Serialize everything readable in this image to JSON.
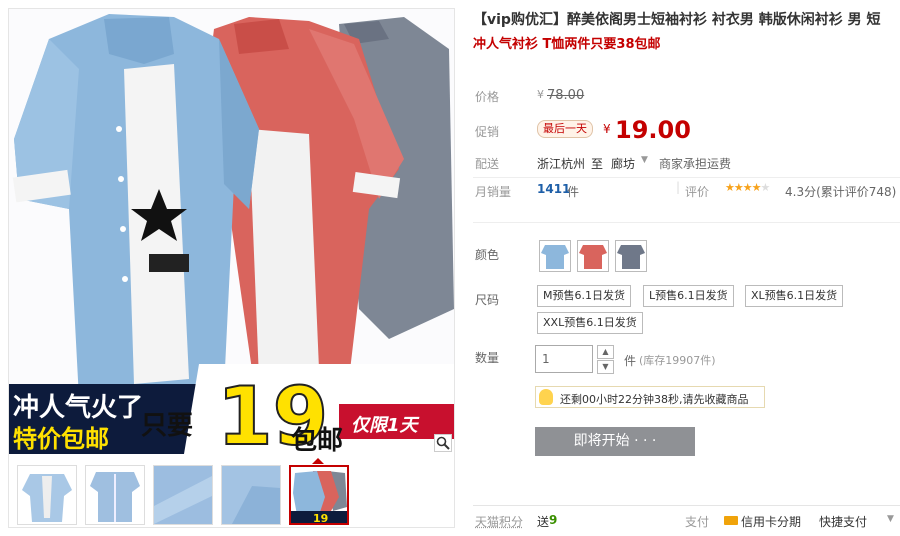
{
  "gallery": {
    "banner": {
      "line1": "冲人气火了",
      "line2": "特价包邮",
      "only": "只要",
      "big_number": "19",
      "shipping": "包邮",
      "limited": "仅限1天"
    },
    "thumbs": [
      {
        "name": "thumb-1"
      },
      {
        "name": "thumb-2"
      },
      {
        "name": "thumb-3"
      },
      {
        "name": "thumb-4"
      },
      {
        "name": "thumb-5",
        "selected": true
      }
    ],
    "zoom_icon": "magnifier-icon"
  },
  "product": {
    "title": "【vip购优汇】醉美依阁男士短袖衬衫 衬衣男 韩版休闲衬衫 男 短",
    "subtitle": "冲人气衬衫 T恤两件只要38包邮"
  },
  "price": {
    "label": "价格",
    "original": "78.00",
    "currency": "¥",
    "promo_label": "促销",
    "promo_tag": "最后一天",
    "current": "19.00"
  },
  "shipping": {
    "label": "配送",
    "from": "浙江杭州",
    "to_word": "至",
    "to": "廊坊",
    "fee": "商家承担运费"
  },
  "sales": {
    "label": "月销量",
    "count": "1411",
    "unit": "件",
    "rating_label": "评价",
    "rating": 4.3,
    "rating_text": "4.3分(累计评价748)"
  },
  "color": {
    "label": "颜色",
    "options": [
      "浅蓝",
      "红色",
      "灰色"
    ]
  },
  "size": {
    "label": "尺码",
    "options": [
      "M预售6.1日发货",
      "L预售6.1日发货",
      "XL预售6.1日发货",
      "XXL预售6.1日发货"
    ]
  },
  "quantity": {
    "label": "数量",
    "value": "1",
    "unit": "件",
    "stock": "(库存19907件)"
  },
  "tip": {
    "text": "还剩00小时22分钟38秒,请先收藏商品"
  },
  "buy_button": {
    "label": "即将开始 · · ·"
  },
  "footer": {
    "points_label": "天猫积分",
    "points_prefix": "送",
    "points": "9",
    "pay_label": "支付",
    "credit": "信用卡分期",
    "express": "快捷支付"
  },
  "colors": {
    "accent": "#c40000",
    "button": "#8f9195",
    "banner_bg": "#0d1b3c",
    "banner_yellow": "#ffe100",
    "star": "#f7a21b"
  }
}
